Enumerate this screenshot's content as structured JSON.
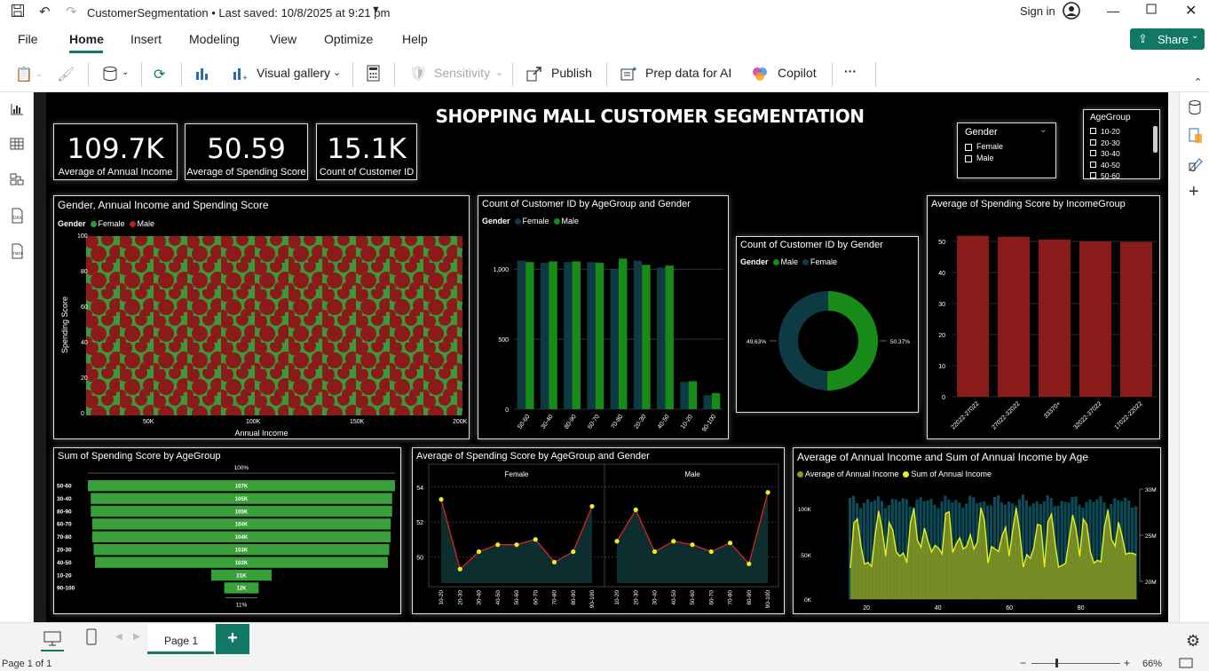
{
  "titlebar": {
    "doc": "CustomerSegmentation",
    "saved": "• Last saved: 10/8/2025 at 9:21 pm",
    "signin": "Sign in"
  },
  "menu": {
    "items": [
      "File",
      "Home",
      "Insert",
      "Modeling",
      "View",
      "Optimize",
      "Help"
    ],
    "share": "Share"
  },
  "ribbon": {
    "visual_gallery": "Visual gallery",
    "sensitivity": "Sensitivity",
    "publish": "Publish",
    "prep": "Prep data for AI",
    "copilot": "Copilot",
    "more": "···"
  },
  "report": {
    "title": "SHOPPING MALL CUSTOMER SEGMENTATION"
  },
  "kpis": [
    {
      "value": "109.7K",
      "label": "Average of Annual Income"
    },
    {
      "value": "50.59",
      "label": "Average of Spending Score"
    },
    {
      "value": "15.1K",
      "label": "Count of Customer ID"
    }
  ],
  "slicers": {
    "gender": {
      "title": "Gender",
      "options": [
        "Female",
        "Male"
      ]
    },
    "agegroup": {
      "title": "AgeGroup",
      "options": [
        "10-20",
        "20-30",
        "30-40",
        "40-50",
        "50-60"
      ]
    }
  },
  "colors": {
    "female": "#2e9a3e",
    "male": "#8b1a1a",
    "teal": "#0e3a44",
    "green": "#178a17",
    "funnel": "#3aa03a",
    "yellow": "#e8f020"
  },
  "chart_data": [
    {
      "type": "scatter",
      "title": "Gender, Annual Income and Spending Score",
      "legend_title": "Gender",
      "series": [
        {
          "name": "Female"
        },
        {
          "name": "Male"
        }
      ],
      "xlabel": "Annual Income",
      "ylabel": "Spending Score",
      "xticks": [
        "50K",
        "100K",
        "150K",
        "200K"
      ],
      "yticks": [
        "0",
        "20",
        "40",
        "60",
        "80",
        "100"
      ],
      "xlim": [
        0,
        200000
      ],
      "ylim": [
        0,
        100
      ]
    },
    {
      "type": "bar",
      "title": "Count of Customer ID by AgeGroup and Gender",
      "legend_title": "Gender",
      "categories": [
        "50-60",
        "30-40",
        "80-90",
        "60-70",
        "70-80",
        "20-30",
        "40-50",
        "10-20",
        "90-100"
      ],
      "series": [
        {
          "name": "Female",
          "values": [
            1060,
            1045,
            1050,
            1050,
            1000,
            1060,
            1010,
            195,
            100
          ]
        },
        {
          "name": "Male",
          "values": [
            1050,
            1055,
            1055,
            1045,
            1075,
            1030,
            1025,
            200,
            115
          ]
        }
      ],
      "yticks": [
        "0",
        "500",
        "1,000"
      ],
      "ylim": [
        0,
        1280
      ]
    },
    {
      "type": "pie",
      "title": "Count of Customer ID by Gender",
      "legend_title": "Gender",
      "series": [
        {
          "name": "Male"
        },
        {
          "name": "Female"
        }
      ],
      "labels": [
        "Male",
        "Female"
      ],
      "values": [
        50.37,
        49.63
      ],
      "value_labels": [
        "50.37%",
        "49.63%"
      ]
    },
    {
      "type": "bar",
      "title": "Average of Spending Score by IncomeGroup",
      "categories": [
        "22022-27022",
        "27022-32022",
        "33370+",
        "32022-37022",
        "17022-22022"
      ],
      "values": [
        51.8,
        51.5,
        50.6,
        50.0,
        49.8
      ],
      "yticks": [
        "0",
        "10",
        "20",
        "30",
        "40",
        "50"
      ],
      "ylim": [
        0,
        56
      ]
    },
    {
      "type": "bar",
      "title": "Sum of Spending Score by AgeGroup",
      "subtype": "funnel",
      "categories": [
        "50-60",
        "30-40",
        "80-90",
        "60-70",
        "70-80",
        "20-30",
        "40-50",
        "10-20",
        "90-100"
      ],
      "values": [
        107,
        105,
        105,
        104,
        104,
        103,
        102,
        21,
        12
      ],
      "value_labels": [
        "107K",
        "105K",
        "105K",
        "104K",
        "104K",
        "103K",
        "102K",
        "21K",
        "12K"
      ],
      "top_label": "100%",
      "bottom_label": "11%"
    },
    {
      "type": "line",
      "title": "Average of Spending Score by AgeGroup and Gender",
      "panels": [
        "Female",
        "Male"
      ],
      "categories": [
        "10-20",
        "20-30",
        "30-40",
        "40-50",
        "50-60",
        "60-70",
        "70-80",
        "80-90",
        "90-100"
      ],
      "series": [
        {
          "name": "Female",
          "values": [
            53.3,
            49.3,
            50.3,
            50.7,
            50.7,
            51.0,
            49.7,
            50.3,
            52.9
          ]
        },
        {
          "name": "Male",
          "values": [
            50.9,
            52.7,
            50.3,
            50.9,
            50.7,
            50.3,
            50.8,
            49.6,
            53.7
          ]
        }
      ],
      "yticks": [
        "50",
        "52",
        "54"
      ],
      "ylim": [
        48.8,
        54.4
      ]
    },
    {
      "type": "area",
      "title": "Average of Annual Income and Sum of Annual Income by Age",
      "series": [
        {
          "name": "Average of Annual Income"
        },
        {
          "name": "Sum of Annual Income"
        }
      ],
      "yticks": [
        "0K",
        "50K",
        "100K"
      ],
      "y2ticks": [
        "20M",
        "25M",
        "30M"
      ],
      "xticks": [
        "20",
        "40",
        "60",
        "80"
      ],
      "xlim": [
        15,
        96
      ]
    }
  ],
  "bottom": {
    "page": "Page 1",
    "add": "+"
  },
  "status": {
    "page_of": "Page 1 of 1",
    "zoom": "66%",
    "minus": "−",
    "plus": "+"
  }
}
